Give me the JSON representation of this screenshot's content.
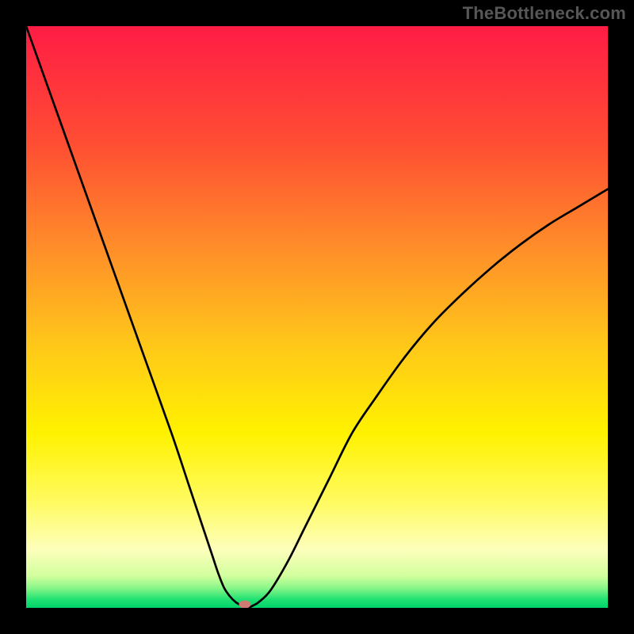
{
  "watermark": "TheBottleneck.com",
  "chart_data": {
    "type": "line",
    "title": "",
    "xlabel": "",
    "ylabel": "",
    "xlim": [
      0,
      100
    ],
    "ylim": [
      0,
      100
    ],
    "x": [
      0,
      5,
      10,
      15,
      20,
      25,
      28,
      30,
      32,
      33,
      34,
      35,
      36,
      37,
      38,
      39,
      40,
      42,
      45,
      48,
      52,
      56,
      60,
      65,
      70,
      75,
      80,
      85,
      90,
      95,
      100
    ],
    "y": [
      100,
      86,
      72,
      58,
      44,
      30,
      21,
      15,
      9,
      6,
      3.5,
      2,
      1,
      0.4,
      0,
      0.4,
      1,
      3,
      8,
      14,
      22,
      30,
      36,
      43,
      49,
      54,
      58.5,
      62.5,
      66,
      69,
      72
    ],
    "background_gradient": {
      "stops": [
        {
          "offset": 0.0,
          "color": "#ff1c45"
        },
        {
          "offset": 0.2,
          "color": "#ff4d33"
        },
        {
          "offset": 0.4,
          "color": "#ff9428"
        },
        {
          "offset": 0.55,
          "color": "#ffc819"
        },
        {
          "offset": 0.7,
          "color": "#fff200"
        },
        {
          "offset": 0.82,
          "color": "#fffb62"
        },
        {
          "offset": 0.9,
          "color": "#fdffbc"
        },
        {
          "offset": 0.945,
          "color": "#d2ff9e"
        },
        {
          "offset": 0.965,
          "color": "#8cf789"
        },
        {
          "offset": 0.985,
          "color": "#22e273"
        },
        {
          "offset": 1.0,
          "color": "#00d36a"
        }
      ]
    },
    "marker": {
      "x": 37.6,
      "y": 0.6,
      "color": "#cf7a73",
      "rx": 7.5,
      "ry": 5
    }
  }
}
